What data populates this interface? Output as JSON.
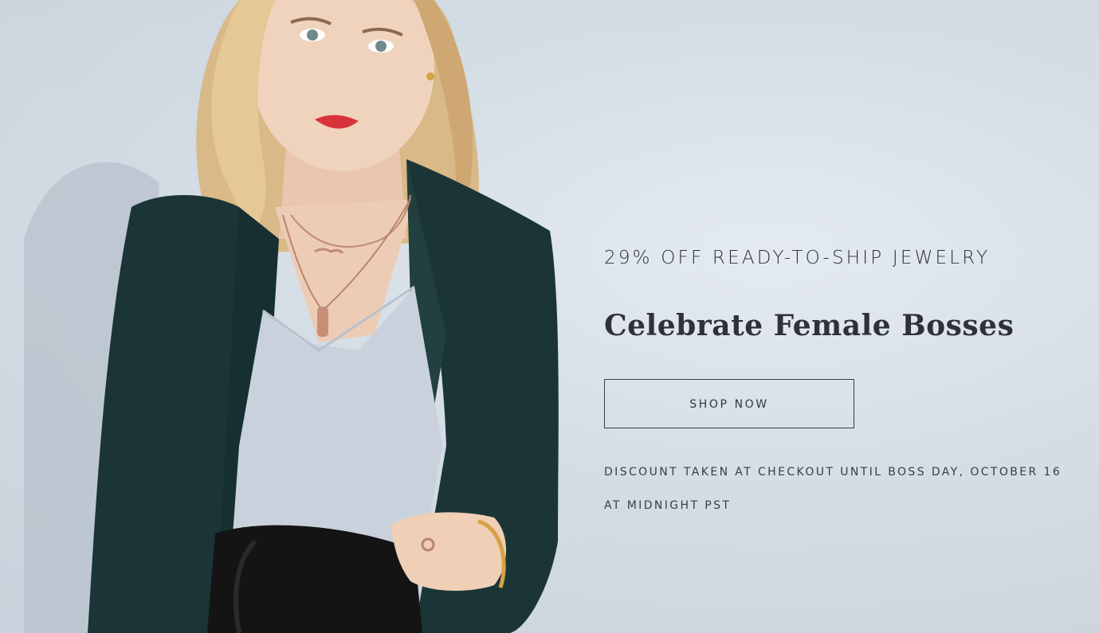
{
  "promo": {
    "eyebrow": "29% OFF READY-TO-SHIP JEWELRY",
    "headline": "Celebrate Female Bosses",
    "cta_label": "SHOP NOW",
    "disclaimer": "DISCOUNT TAKEN AT CHECKOUT UNTIL BOSS DAY, OCTOBER 16 AT MIDNIGHT PST"
  },
  "colors": {
    "background": "#d3dbe4",
    "blazer": "#1b3536",
    "top": "#c9d2dc",
    "text": "#2e3238"
  }
}
